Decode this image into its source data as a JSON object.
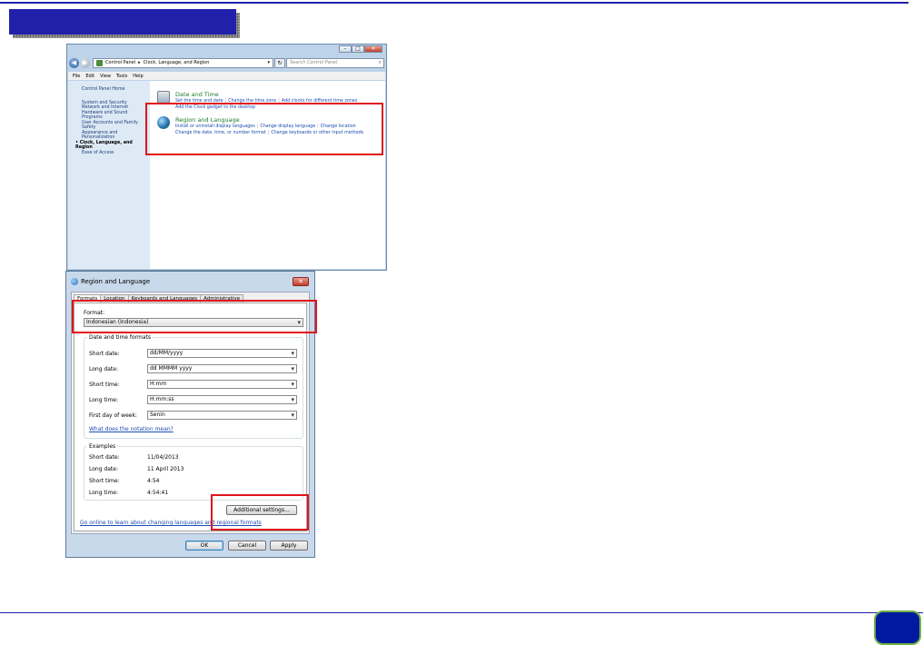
{
  "control_panel": {
    "address": {
      "back_glyph": "◀",
      "forward_glyph": "▶",
      "crumbs": [
        "Control Panel",
        "Clock, Language, and Region"
      ],
      "search_placeholder": "Search Control Panel"
    },
    "caption_buttons": [
      "–",
      "□",
      "✕"
    ],
    "menu": [
      "File",
      "Edit",
      "View",
      "Tools",
      "Help"
    ],
    "sidebar": {
      "home": "Control Panel Home",
      "items": [
        "System and Security",
        "Network and Internet",
        "Hardware and Sound",
        "Programs",
        "User Accounts and Family Safety",
        "Appearance and Personalization",
        "Clock, Language, and Region",
        "Ease of Access"
      ]
    },
    "categories": {
      "date_time": {
        "title": "Date and Time",
        "links": [
          "Set the time and date",
          "Change the time zone",
          "Add clocks for different time zones",
          "Add the Clock gadget to the desktop"
        ]
      },
      "region_language": {
        "title": "Region and Language",
        "links": [
          "Install or uninstall display languages",
          "Change display language",
          "Change location",
          "Change the date, time, or number format",
          "Change keyboards or other input methods"
        ]
      }
    }
  },
  "region_dialog": {
    "title": "Region and Language",
    "close_glyph": "✕",
    "tabs": [
      "Formats",
      "Location",
      "Keyboards and Languages",
      "Administrative"
    ],
    "format_label": "Format:",
    "format_value": "Indonesian (Indonesia)",
    "date_time_group": "Date and time formats",
    "fields": [
      {
        "label": "Short date:",
        "value": "dd/MM/yyyy"
      },
      {
        "label": "Long date:",
        "value": "dd MMMM yyyy"
      },
      {
        "label": "Short time:",
        "value": "H:mm"
      },
      {
        "label": "Long time:",
        "value": "H:mm:ss"
      },
      {
        "label": "First day of week:",
        "value": "Senin"
      }
    ],
    "notation_link": "What does the notation mean?",
    "examples_group": "Examples",
    "examples": [
      {
        "label": "Short date:",
        "value": "11/04/2013"
      },
      {
        "label": "Long date:",
        "value": "11 April 2013"
      },
      {
        "label": "Short time:",
        "value": "4:54"
      },
      {
        "label": "Long time:",
        "value": "4:54:41"
      }
    ],
    "additional_settings": "Additional settings...",
    "online_link": "Go online to learn about changing languages and regional formats",
    "buttons": {
      "ok": "OK",
      "cancel": "Cancel",
      "apply": "Apply"
    }
  },
  "colors": {
    "highlight": "#e0141a",
    "slide_blue": "#2020aa",
    "link_blue": "#1a4cb1",
    "category_green": "#1e7a2a"
  }
}
